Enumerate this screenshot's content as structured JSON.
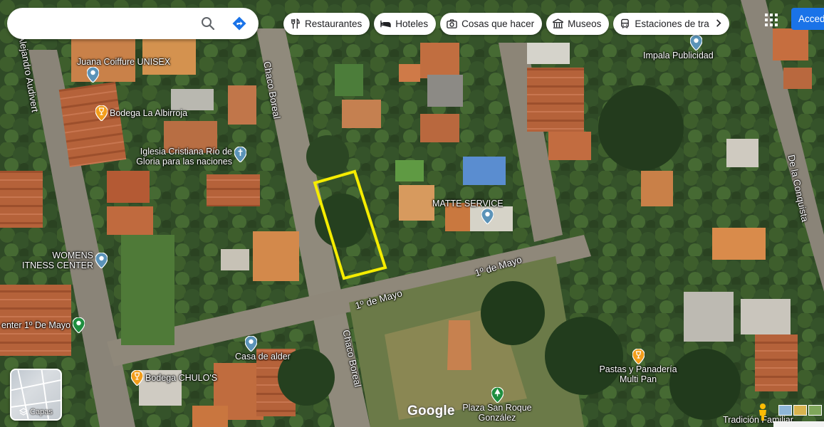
{
  "search": {
    "placeholder": ""
  },
  "chips": [
    {
      "icon": "fork-knife-icon",
      "label": "Restaurantes"
    },
    {
      "icon": "bed-icon",
      "label": "Hoteles"
    },
    {
      "icon": "camera-icon",
      "label": "Cosas que hacer"
    },
    {
      "icon": "museum-icon",
      "label": "Museos"
    },
    {
      "icon": "bus-icon",
      "label": "Estaciones de tra"
    }
  ],
  "signin_label": "Acced",
  "layers_label": "Capas",
  "logo_text": "Google",
  "places": {
    "juana": "Juana Coiffure UNISEX",
    "bodega_albirroja": "Bodega La Albirroja",
    "iglesia": "Iglesia Cristiana Río de Gloria para las naciones",
    "matte": "MATTE SERVICE",
    "impala": "Impala Publicidad",
    "womens_1": "WOMENS",
    "womens_2": "ITNESS CENTER",
    "center": "enter 1º De Mayo",
    "casa_alder": "Casa de alder",
    "bodega_chulos": "Bodega CHULO'S",
    "pastas": "Pastas y Panadería Multi Pan",
    "plaza": "Plaza San Roque González",
    "tradicion": "Tradición Familiar"
  },
  "streets": {
    "audivert": "Alejandro Audivert",
    "chaco_top": "Chaco Boreal",
    "chaco_bottom": "Chaco Boreal",
    "mayo_left": "1º de Mayo",
    "mayo_right": "1º de Mayo",
    "conquista": "De la Conquista"
  },
  "colors": {
    "highlight": "#f5ec00",
    "pin_blue": "#5b93b8",
    "pin_orange": "#f29e1c",
    "pin_green": "#1e8e3e",
    "button_blue": "#1a73e8"
  }
}
